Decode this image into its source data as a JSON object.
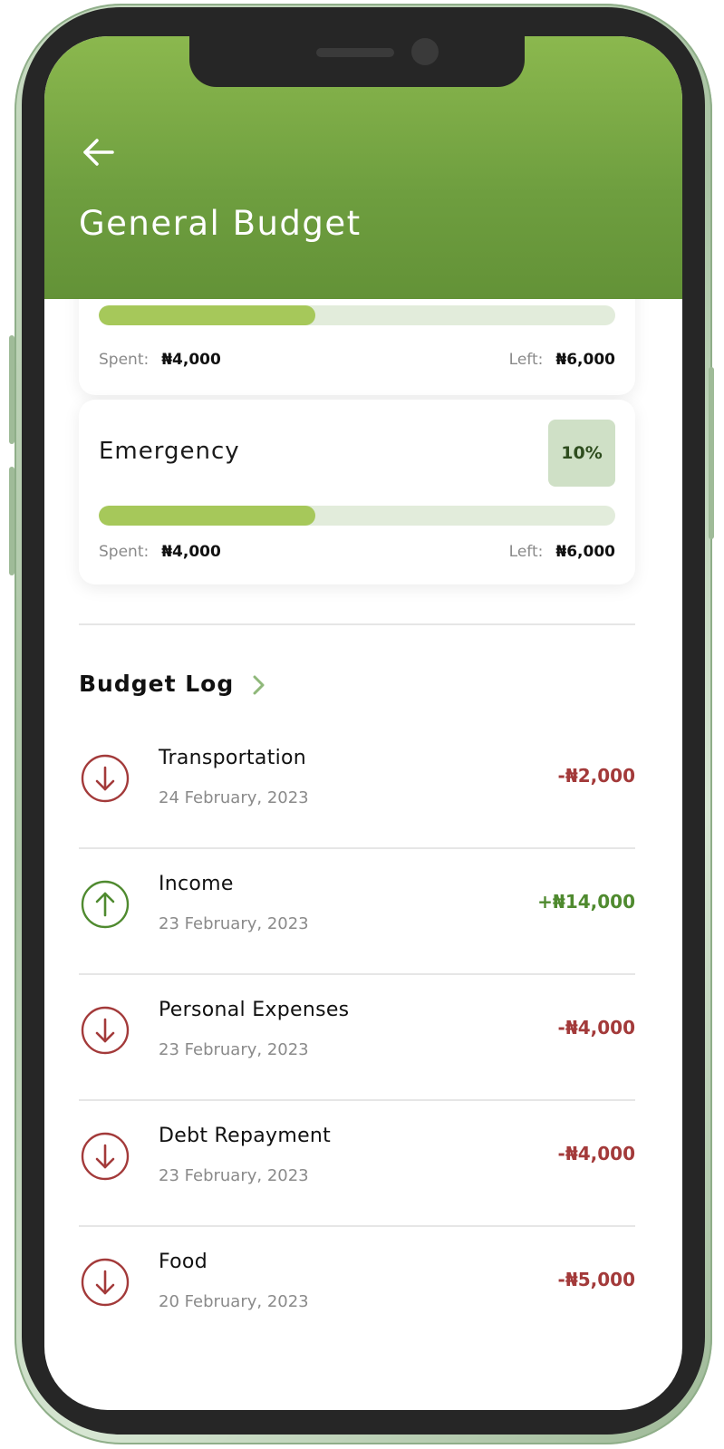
{
  "header": {
    "title": "General Budget",
    "back_icon": "arrow-left-icon"
  },
  "colors": {
    "header_green": "#6e9e3f",
    "progress_fill": "#a6c85a",
    "expense_red": "#a33a3a",
    "income_green": "#4f8a2f"
  },
  "cards": [
    {
      "spent_label": "Spent:",
      "spent_value": "₦4,000",
      "left_label": "Left:",
      "left_value": "₦6,000",
      "progress": 0.42
    },
    {
      "name": "Emergency",
      "percent": "10%",
      "spent_label": "Spent:",
      "spent_value": "₦4,000",
      "left_label": "Left:",
      "left_value": "₦6,000",
      "progress": 0.42
    }
  ],
  "budget_log": {
    "title": "Budget Log",
    "chevron_icon": "chevron-right-icon",
    "items": [
      {
        "name": "Transportation",
        "date": "24 February, 2023",
        "amount": "-₦2,000",
        "direction": "down"
      },
      {
        "name": "Income",
        "date": "23 February, 2023",
        "amount": "+₦14,000",
        "direction": "up"
      },
      {
        "name": "Personal Expenses",
        "date": "23 February, 2023",
        "amount": "-₦4,000",
        "direction": "down"
      },
      {
        "name": "Debt Repayment",
        "date": "23 February, 2023",
        "amount": "-₦4,000",
        "direction": "down"
      },
      {
        "name": "Food",
        "date": "20 February, 2023",
        "amount": "-₦5,000",
        "direction": "down"
      }
    ]
  }
}
